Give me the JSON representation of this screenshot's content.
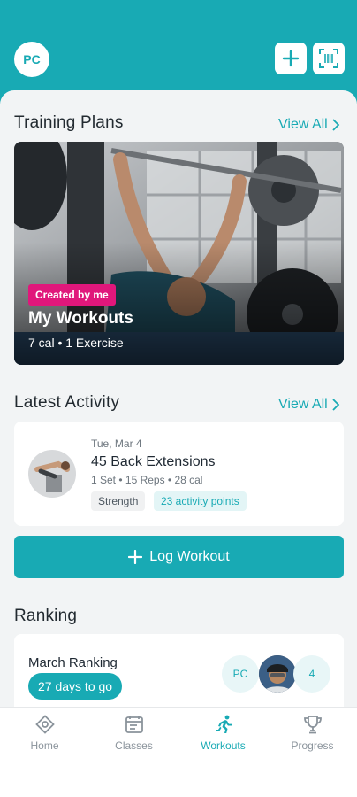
{
  "header": {
    "avatar_initials": "PC",
    "add_icon": "plus-icon",
    "scan_icon": "barcode-scan-icon",
    "background": "#18aab4"
  },
  "training_plans": {
    "title": "Training Plans",
    "view_all": "View All",
    "card": {
      "badge": "Created by me",
      "title": "My Workouts",
      "subtitle": "7 cal • 1 Exercise",
      "badge_color": "#e0177b"
    }
  },
  "latest_activity": {
    "title": "Latest Activity",
    "view_all": "View All",
    "item": {
      "date": "Tue, Mar 4",
      "name": "45 Back Extensions",
      "meta": "1 Set • 15 Reps • 28 cal",
      "chip_category": "Strength",
      "chip_points": "23 activity points"
    }
  },
  "log_workout": {
    "label": "Log Workout"
  },
  "ranking": {
    "title": "Ranking",
    "card": {
      "label": "March Ranking",
      "pill": "27 days to go",
      "participant_initials": "PC",
      "extra_count": "4"
    }
  },
  "bottom_nav": {
    "items": [
      {
        "label": "Home",
        "icon": "home-icon"
      },
      {
        "label": "Classes",
        "icon": "classes-icon"
      },
      {
        "label": "Workouts",
        "icon": "workouts-icon",
        "active": true
      },
      {
        "label": "Progress",
        "icon": "trophy-icon"
      }
    ]
  },
  "colors": {
    "accent": "#18aab4",
    "sheet_bg": "#f2f4f5"
  }
}
